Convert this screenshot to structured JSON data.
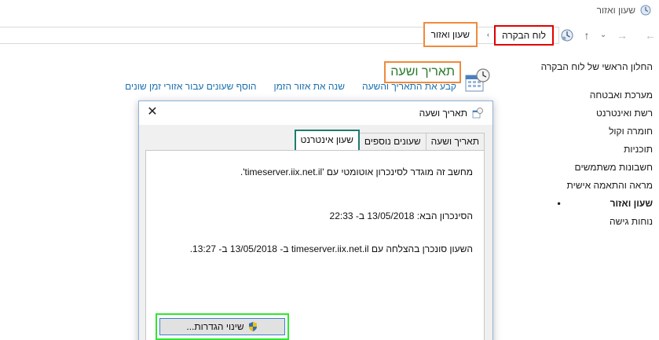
{
  "window": {
    "title": "שעון ואזור"
  },
  "nav": {
    "back_icon": "arrow-left-icon",
    "forward_icon": "arrow-right-icon",
    "recent_icon": "chevron-down-icon",
    "up_icon": "arrow-up-icon",
    "breadcrumbs": [
      "לוח הבקרה",
      "שעון ואזור"
    ],
    "separator": "›"
  },
  "sidebar": {
    "home": "החלון הראשי של לוח הבקרה",
    "items": [
      {
        "label": "מערכת ואבטחה",
        "active": false
      },
      {
        "label": "רשת ואינטרנט",
        "active": false
      },
      {
        "label": "חומרה וקול",
        "active": false
      },
      {
        "label": "תוכניות",
        "active": false
      },
      {
        "label": "חשבונות משתמשים",
        "active": false
      },
      {
        "label": "מראה והתאמה אישית",
        "active": false
      },
      {
        "label": "שעון ואזור",
        "active": true
      },
      {
        "label": "נוחות גישה",
        "active": false
      }
    ]
  },
  "main": {
    "title": "תאריך ושעה",
    "links": [
      "קבע את התאריך והשעה",
      "שנה את אזור הזמן",
      "הוסף שעונים עבור אזורי זמן שונים"
    ]
  },
  "dialog": {
    "title": "תאריך ושעה",
    "close_label": "✕",
    "tabs": [
      {
        "label": "תאריך ושעה",
        "active": false
      },
      {
        "label": "שעונים נוספים",
        "active": false
      },
      {
        "label": "שעון אינטרנט",
        "active": true
      }
    ],
    "lines": [
      "מחשב זה מוגדר לסינכרון אוטומטי עם 'timeserver.iix.net.il'.",
      "הסינכרון הבא: 13/05/2018 ב- 22:33",
      "השעון סונכרן בהצלחה עם timeserver.iix.net.il ב- 13/05/2018 ב- 13:27."
    ],
    "change_button": "שינוי הגדרות..."
  },
  "colors": {
    "accent_link": "#1a6fb0",
    "title_green": "#2a7a2a",
    "highlight_red": "#e00000",
    "highlight_orange": "#f08a3c",
    "highlight_teal": "#1e7b6e",
    "highlight_green": "#2ee82e"
  }
}
